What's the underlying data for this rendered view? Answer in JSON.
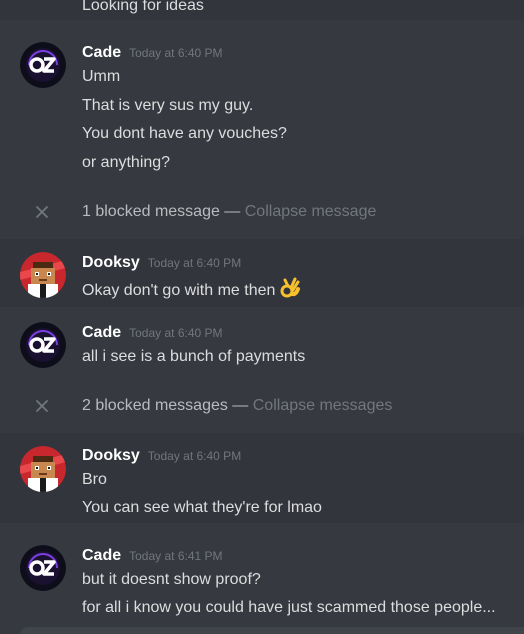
{
  "messages": {
    "top_line": "Looking for ideas",
    "cade1": {
      "username": "Cade",
      "timestamp": "Today at 6:40 PM",
      "lines": [
        "Umm",
        "That is very sus my guy.",
        "You dont have any vouches?",
        "or anything?"
      ]
    },
    "blocked1": {
      "text": "1 blocked message",
      "separator": " — ",
      "link": "Collapse message"
    },
    "dooksy1": {
      "username": "Dooksy",
      "timestamp": "Today at 6:40 PM",
      "lines": [
        "Okay don't go with me then"
      ],
      "emoji": "ok-hand-emoji"
    },
    "cade2": {
      "username": "Cade",
      "timestamp": "Today at 6:40 PM",
      "lines": [
        "all i see is a bunch of payments"
      ]
    },
    "blocked2": {
      "text": "2 blocked messages",
      "separator": " — ",
      "link": "Collapse messages"
    },
    "dooksy2": {
      "username": "Dooksy",
      "timestamp": "Today at 6:40 PM",
      "lines": [
        "Bro",
        "You can see what they're for lmao"
      ]
    },
    "cade3": {
      "username": "Cade",
      "timestamp": "Today at 6:41 PM",
      "lines": [
        "but it doesnt show proof?",
        "for all i know you could have just scammed those people..."
      ]
    }
  },
  "colors": {
    "background": "#36393f",
    "hover_strip": "#32353b",
    "username": "#ffffff",
    "timestamp": "#72767d",
    "message_text": "#dcddde"
  },
  "icons": {
    "cade_avatar": "cade-avatar-logo",
    "dooksy_avatar": "dooksy-avatar-character",
    "blocked_close": "close-icon"
  }
}
